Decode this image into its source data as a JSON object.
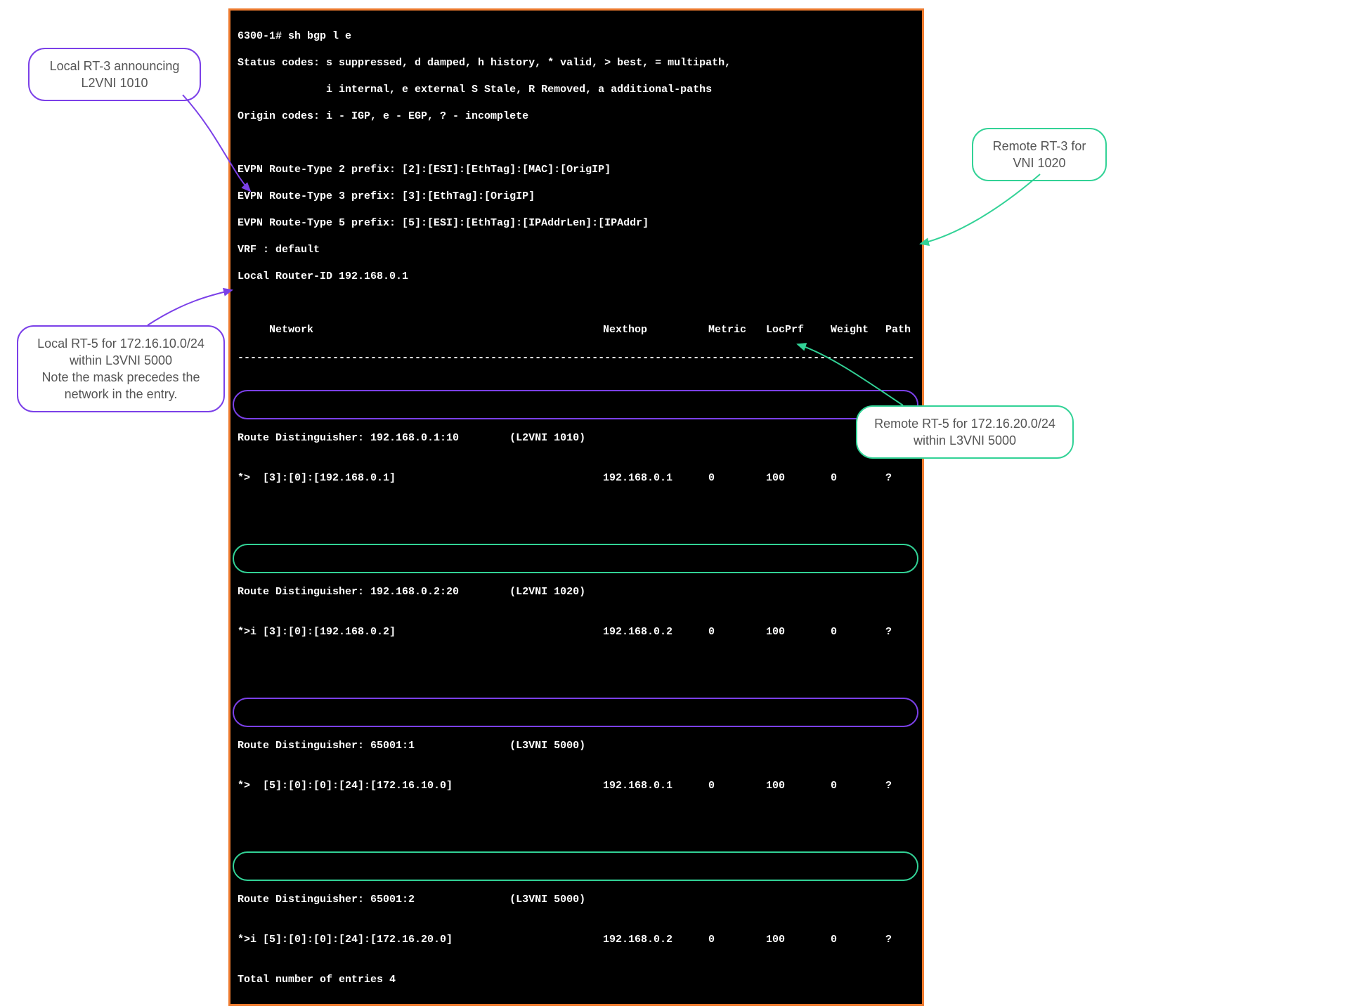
{
  "terminal": {
    "prompt": "6300-1# sh bgp l e",
    "status_codes": "Status codes: s suppressed, d damped, h history, * valid, > best, = multipath,",
    "status_codes2": "              i internal, e external S Stale, R Removed, a additional-paths",
    "origin_codes": "Origin codes: i - IGP, e - EGP, ? - incomplete",
    "rt2": "EVPN Route-Type 2 prefix: [2]:[ESI]:[EthTag]:[MAC]:[OrigIP]",
    "rt3": "EVPN Route-Type 3 prefix: [3]:[EthTag]:[OrigIP]",
    "rt5": "EVPN Route-Type 5 prefix: [5]:[ESI]:[EthTag]:[IPAddrLen]:[IPAddr]",
    "vrf": "VRF : default",
    "router_id": "Local Router-ID 192.168.0.1",
    "headers": {
      "network": "Network",
      "nexthop": "Nexthop",
      "metric": "Metric",
      "locprf": "LocPrf",
      "weight": "Weight",
      "path": "Path"
    },
    "dashes": "-----------------------------------------------------------------------------------------------------------",
    "entries": [
      {
        "rd": "Route Distinguisher: 192.168.0.1:10        (L2VNI 1010)",
        "net": "*>  [3]:[0]:[192.168.0.1]",
        "hop": "192.168.0.1",
        "met": "0",
        "loc": "100",
        "wgt": "0",
        "path": "?",
        "color": "purple"
      },
      {
        "rd": "Route Distinguisher: 192.168.0.2:20        (L2VNI 1020)",
        "net": "*>i [3]:[0]:[192.168.0.2]",
        "hop": "192.168.0.2",
        "met": "0",
        "loc": "100",
        "wgt": "0",
        "path": "?",
        "color": "green"
      },
      {
        "rd": "Route Distinguisher: 65001:1               (L3VNI 5000)",
        "net": "*>  [5]:[0]:[0]:[24]:[172.16.10.0]",
        "hop": "192.168.0.1",
        "met": "0",
        "loc": "100",
        "wgt": "0",
        "path": "?",
        "color": "purple"
      },
      {
        "rd": "Route Distinguisher: 65001:2               (L3VNI 5000)",
        "net": "*>i [5]:[0]:[0]:[24]:[172.16.20.0]",
        "hop": "192.168.0.2",
        "met": "0",
        "loc": "100",
        "wgt": "0",
        "path": "?",
        "color": "green"
      }
    ],
    "total": "Total number of entries 4"
  },
  "callouts": {
    "c1": "Local RT-3 announcing\nL2VNI 1010",
    "c2": "Remote RT-3 for\nVNI 1020",
    "c3": "Local RT-5 for 172.16.10.0/24\nwithin L3VNI 5000\nNote the mask precedes the\nnetwork in the entry.",
    "c4": "Remote RT-5 for 172.16.20.0/24\nwithin L3VNI 5000"
  }
}
